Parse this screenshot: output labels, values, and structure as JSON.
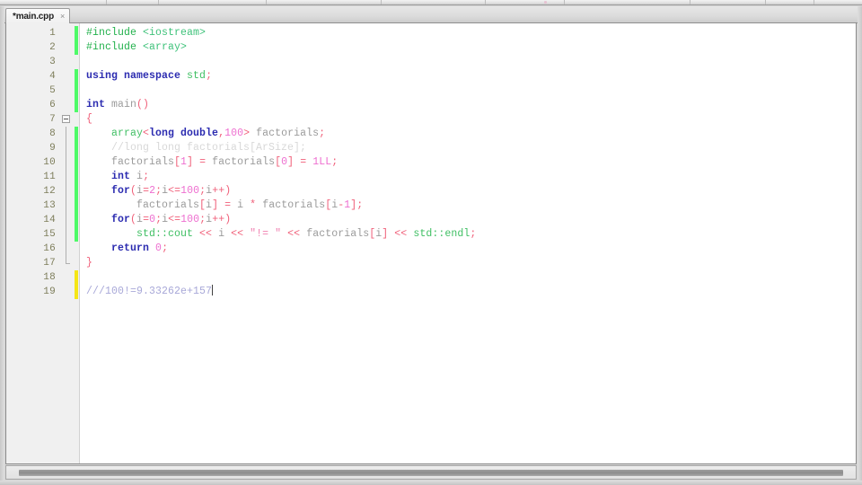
{
  "window": {
    "title": "main.cpp"
  },
  "toolbar": {
    "separator_count": 9
  },
  "tab_bar": {
    "tabs": [
      {
        "label": "*main.cpp",
        "close_glyph": "×",
        "modified": true,
        "active": true
      }
    ]
  },
  "editor": {
    "language": "C++",
    "caret_line": 19,
    "caret_column": 21,
    "gutter": {
      "line_numbers": [
        1,
        2,
        3,
        4,
        5,
        6,
        7,
        8,
        9,
        10,
        11,
        12,
        13,
        14,
        15,
        16,
        17,
        18,
        19
      ],
      "fold_marker_line": 7,
      "fold_end_line": 17,
      "change_marker_colors": {
        "saved": "#4efa68",
        "unsaved": "#f5e617"
      },
      "change_markers": [
        {
          "line": 1,
          "state": "saved"
        },
        {
          "line": 2,
          "state": "saved"
        },
        {
          "line": 3,
          "state": "none"
        },
        {
          "line": 4,
          "state": "saved"
        },
        {
          "line": 5,
          "state": "saved"
        },
        {
          "line": 6,
          "state": "saved"
        },
        {
          "line": 7,
          "state": "none"
        },
        {
          "line": 8,
          "state": "saved"
        },
        {
          "line": 9,
          "state": "saved"
        },
        {
          "line": 10,
          "state": "saved"
        },
        {
          "line": 11,
          "state": "saved"
        },
        {
          "line": 12,
          "state": "saved"
        },
        {
          "line": 13,
          "state": "saved"
        },
        {
          "line": 14,
          "state": "saved"
        },
        {
          "line": 15,
          "state": "saved"
        },
        {
          "line": 16,
          "state": "none"
        },
        {
          "line": 17,
          "state": "none"
        },
        {
          "line": 18,
          "state": "unsaved"
        },
        {
          "line": 19,
          "state": "unsaved"
        }
      ]
    },
    "lines": [
      {
        "n": 1,
        "text": "#include <iostream>"
      },
      {
        "n": 2,
        "text": "#include <array>"
      },
      {
        "n": 3,
        "text": ""
      },
      {
        "n": 4,
        "text": "using namespace std;"
      },
      {
        "n": 5,
        "text": ""
      },
      {
        "n": 6,
        "text": "int main()"
      },
      {
        "n": 7,
        "text": "{"
      },
      {
        "n": 8,
        "text": "    array<long double,100> factorials;"
      },
      {
        "n": 9,
        "text": "    //long long factorials[ArSize];"
      },
      {
        "n": 10,
        "text": "    factorials[1] = factorials[0] = 1LL;"
      },
      {
        "n": 11,
        "text": "    int i;"
      },
      {
        "n": 12,
        "text": "    for(i=2;i<=100;i++)"
      },
      {
        "n": 13,
        "text": "        factorials[i] = i * factorials[i-1];"
      },
      {
        "n": 14,
        "text": "    for(i=0;i<=100;i++)"
      },
      {
        "n": 15,
        "text": "        std::cout << i << \"!= \" << factorials[i] << std::endl;"
      },
      {
        "n": 16,
        "text": "    return 0;"
      },
      {
        "n": 17,
        "text": "}"
      },
      {
        "n": 18,
        "text": ""
      },
      {
        "n": 19,
        "text": "///100!=9.33262e+157"
      }
    ],
    "syntax_colors": {
      "preprocessor": "#22b14c",
      "header": "#3ec27a",
      "keyword": "#2b2bb0",
      "identifier": "#9b9b9b",
      "std_symbol": "#3fbf63",
      "number": "#ee6fd0",
      "operator": "#f0607a",
      "string": "#f07fb0",
      "comment_faded": "#d8d8d8",
      "comment_blue": "#a8a8d8",
      "background": "#ffffff",
      "gutter_background": "#f0f0f0",
      "line_number": "#7d7d5a"
    }
  },
  "scrollbar": {
    "orientation": "horizontal",
    "thumb_fraction": 0.97,
    "position": 0
  }
}
